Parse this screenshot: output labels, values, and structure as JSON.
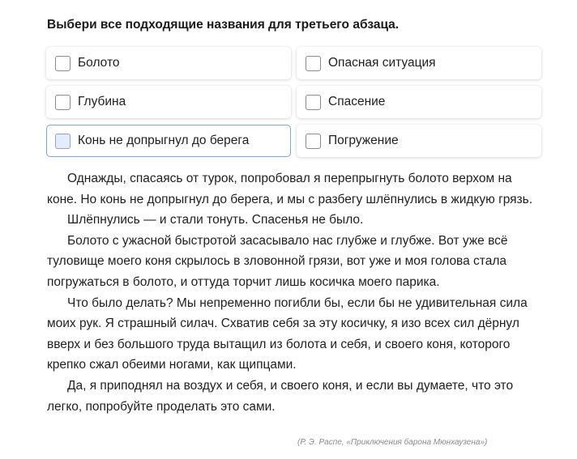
{
  "question": "Выбери все подходящие названия для третьего абзаца.",
  "options": [
    {
      "label": "Болото",
      "checked": false
    },
    {
      "label": "Опасная ситуация",
      "checked": false
    },
    {
      "label": "Глубина",
      "checked": false
    },
    {
      "label": "Спасение",
      "checked": false
    },
    {
      "label": "Конь не допрыгнул до берега",
      "checked": false,
      "focused": true
    },
    {
      "label": "Погружение",
      "checked": false
    }
  ],
  "text": {
    "paragraphs": [
      "Однажды, спасаясь от турок, попробовал я перепрыгнуть болото верхом на коне. Но конь не допрыгнул до берега, и мы с разбегу шлёпнулись в жидкую грязь.",
      "Шлёпнулись — и стали тонуть. Спасенья не было.",
      "Болото с ужасной быстротой засасывало нас глубже и глубже. Вот уже всё туловище моего коня скрылось в зловонной грязи, вот уже и моя голова стала погружаться в болото, и оттуда торчит лишь косичка моего парика.",
      "Что было делать? Мы непременно погибли бы, если бы не удивительная сила моих рук. Я страшный силач. Схватив себя за эту косичку, я изо всех сил дёрнул вверх и без большого труда вытащил из болота и себя, и своего коня, которого крепко сжал обеими ногами, как щипцами.",
      "Да, я приподнял на воздух и себя, и своего коня, и если вы думаете, что это легко, попробуйте проделать это сами."
    ],
    "source": "(Р. Э. Распе, «Приключения барона Мюнхаузена»)"
  },
  "colors": {
    "focus_border": "#7aa6de",
    "focus_checkbox_fill": "#e4ebfb",
    "text": "#1f1f1f",
    "source": "#8a8a8a"
  }
}
